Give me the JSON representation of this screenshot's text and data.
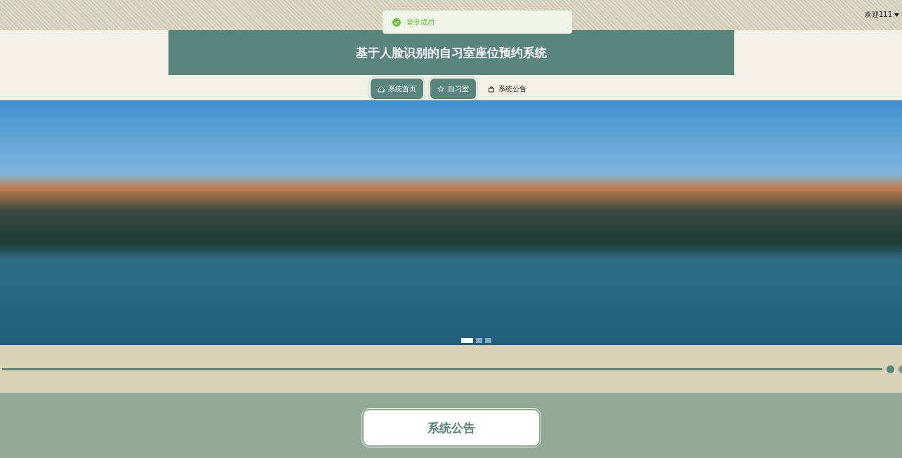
{
  "toast": {
    "message": "登录成功"
  },
  "user_menu": {
    "label": "欢迎111"
  },
  "header": {
    "title": "基于人脸识别的自习室座位预约系统"
  },
  "nav": [
    {
      "label": "系统首页",
      "selected": true
    },
    {
      "label": "自习室",
      "selected": true
    },
    {
      "label": "系统公告",
      "selected": false
    }
  ],
  "carousel": {
    "dots": [
      {
        "selected": true
      },
      {
        "selected": false
      },
      {
        "selected": false
      }
    ]
  },
  "section": {
    "title": "系统公告"
  }
}
